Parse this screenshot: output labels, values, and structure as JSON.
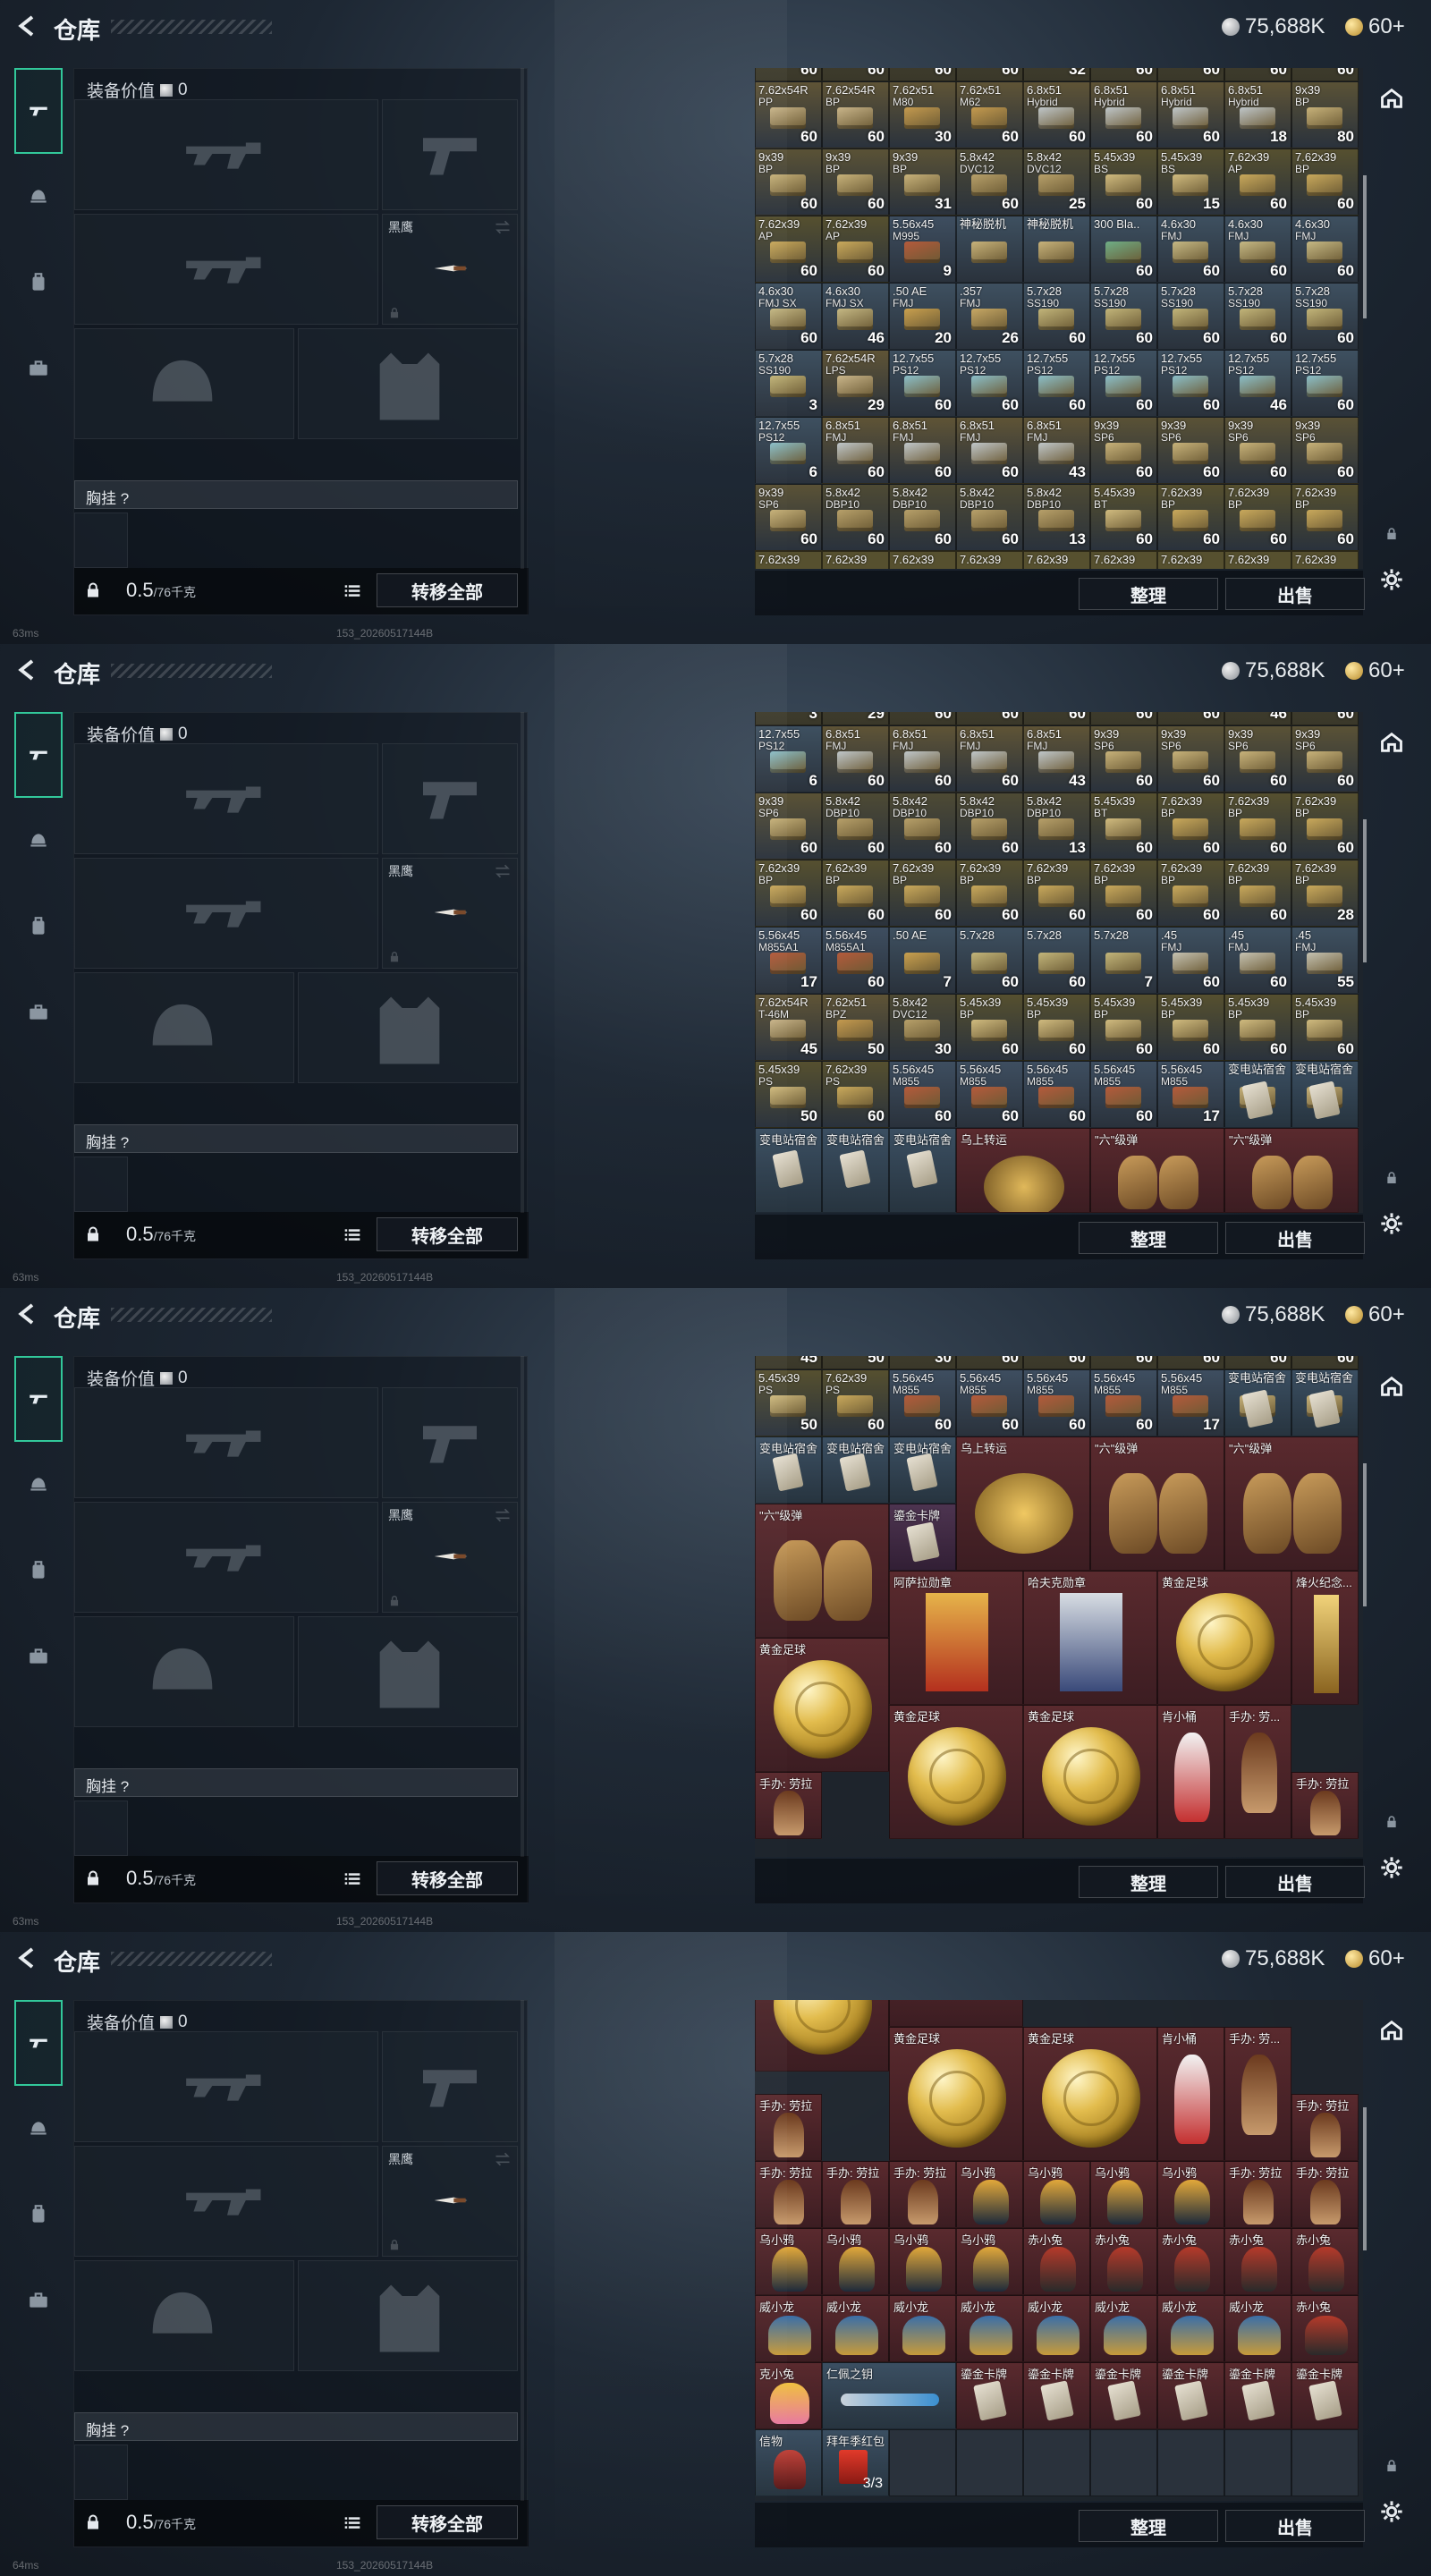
{
  "header": {
    "title": "仓库",
    "silver": "75,688K",
    "gold": "60+"
  },
  "left": {
    "equip_value_label": "装备价值",
    "equip_value": "0",
    "melee_label": "黑鹰",
    "chest_rig_label": "胸挂 ?",
    "weight": "0.5",
    "weight_max": "/76千克",
    "transfer_label": "转移全部"
  },
  "stash_buttons": {
    "sort_label": "整理",
    "sell_label": "出售"
  },
  "status": {
    "ping_1": "63ms",
    "ping_4": "64ms",
    "build_id": "153_20260517144B"
  },
  "screens": [
    {
      "top_counts": [
        "60",
        "60",
        "60",
        "60",
        "32",
        "60",
        "60",
        "60",
        "60"
      ],
      "rows": [
        [
          [
            "7.62x54R",
            "PP",
            "60"
          ],
          [
            "7.62x54R",
            "BP",
            "60"
          ],
          [
            "7.62x51",
            "M80",
            "30"
          ],
          [
            "7.62x51",
            "M62",
            "60"
          ],
          [
            "6.8x51",
            "Hybrid",
            "60"
          ],
          [
            "6.8x51",
            "Hybrid",
            "60"
          ],
          [
            "6.8x51",
            "Hybrid",
            "60"
          ],
          [
            "6.8x51",
            "Hybrid",
            "18"
          ],
          [
            "9x39",
            "BP",
            "80"
          ]
        ],
        [
          [
            "9x39",
            "BP",
            "60"
          ],
          [
            "9x39",
            "BP",
            "60"
          ],
          [
            "9x39",
            "BP",
            "31"
          ],
          [
            "5.8x42",
            "DVC12",
            "60"
          ],
          [
            "5.8x42",
            "DVC12",
            "25"
          ],
          [
            "5.45x39",
            "BS",
            "60"
          ],
          [
            "5.45x39",
            "BS",
            "15"
          ],
          [
            "7.62x39",
            "AP",
            "60"
          ],
          [
            "7.62x39",
            "BP",
            "60"
          ]
        ],
        [
          [
            "7.62x39",
            "AP",
            "60"
          ],
          [
            "7.62x39",
            "AP",
            "60"
          ],
          [
            "5.56x45",
            "M995",
            "9"
          ],
          [
            "神秘脱机",
            "",
            ""
          ],
          [
            "神秘脱机",
            "",
            ""
          ],
          [
            "300 Bla..",
            "",
            "60"
          ],
          [
            "4.6x30",
            "FMJ",
            "60"
          ],
          [
            "4.6x30",
            "FMJ",
            "60"
          ],
          [
            "4.6x30",
            "FMJ",
            "60"
          ]
        ],
        [
          [
            "4.6x30",
            "FMJ SX",
            "60"
          ],
          [
            "4.6x30",
            "FMJ SX",
            "46"
          ],
          [
            ".50 AE",
            "FMJ",
            "20"
          ],
          [
            ".357",
            "FMJ",
            "26"
          ],
          [
            "5.7x28",
            "SS190",
            "60"
          ],
          [
            "5.7x28",
            "SS190",
            "60"
          ],
          [
            "5.7x28",
            "SS190",
            "60"
          ],
          [
            "5.7x28",
            "SS190",
            "60"
          ],
          [
            "5.7x28",
            "SS190",
            "60"
          ]
        ],
        [
          [
            "5.7x28",
            "SS190",
            "3"
          ],
          [
            "7.62x54R",
            "LPS",
            "29"
          ],
          [
            "12.7x55",
            "PS12",
            "60"
          ],
          [
            "12.7x55",
            "PS12",
            "60"
          ],
          [
            "12.7x55",
            "PS12",
            "60"
          ],
          [
            "12.7x55",
            "PS12",
            "60"
          ],
          [
            "12.7x55",
            "PS12",
            "60"
          ],
          [
            "12.7x55",
            "PS12",
            "46"
          ],
          [
            "12.7x55",
            "PS12",
            "60"
          ]
        ],
        [
          [
            "12.7x55",
            "PS12",
            "6"
          ],
          [
            "6.8x51",
            "FMJ",
            "60"
          ],
          [
            "6.8x51",
            "FMJ",
            "60"
          ],
          [
            "6.8x51",
            "FMJ",
            "60"
          ],
          [
            "6.8x51",
            "FMJ",
            "43"
          ],
          [
            "9x39",
            "SP6",
            "60"
          ],
          [
            "9x39",
            "SP6",
            "60"
          ],
          [
            "9x39",
            "SP6",
            "60"
          ],
          [
            "9x39",
            "SP6",
            "60"
          ]
        ],
        [
          [
            "9x39",
            "SP6",
            "60"
          ],
          [
            "5.8x42",
            "DBP10",
            "60"
          ],
          [
            "5.8x42",
            "DBP10",
            "60"
          ],
          [
            "5.8x42",
            "DBP10",
            "60"
          ],
          [
            "5.8x42",
            "DBP10",
            "13"
          ],
          [
            "5.45x39",
            "BT",
            "60"
          ],
          [
            "7.62x39",
            "BP",
            "60"
          ],
          [
            "7.62x39",
            "BP",
            "60"
          ],
          [
            "7.62x39",
            "BP",
            "60"
          ]
        ]
      ],
      "bottom_names": [
        "7.62x39",
        "7.62x39",
        "7.62x39",
        "7.62x39",
        "7.62x39",
        "7.62x39",
        "7.62x39",
        "7.62x39",
        "7.62x39"
      ]
    },
    {
      "top_counts": [
        "3",
        "29",
        "60",
        "60",
        "60",
        "60",
        "60",
        "46",
        "60"
      ],
      "rows": [
        [
          [
            "12.7x55",
            "PS12",
            "6"
          ],
          [
            "6.8x51",
            "FMJ",
            "60"
          ],
          [
            "6.8x51",
            "FMJ",
            "60"
          ],
          [
            "6.8x51",
            "FMJ",
            "60"
          ],
          [
            "6.8x51",
            "FMJ",
            "43"
          ],
          [
            "9x39",
            "SP6",
            "60"
          ],
          [
            "9x39",
            "SP6",
            "60"
          ],
          [
            "9x39",
            "SP6",
            "60"
          ],
          [
            "9x39",
            "SP6",
            "60"
          ]
        ],
        [
          [
            "9x39",
            "SP6",
            "60"
          ],
          [
            "5.8x42",
            "DBP10",
            "60"
          ],
          [
            "5.8x42",
            "DBP10",
            "60"
          ],
          [
            "5.8x42",
            "DBP10",
            "60"
          ],
          [
            "5.8x42",
            "DBP10",
            "13"
          ],
          [
            "5.45x39",
            "BT",
            "60"
          ],
          [
            "7.62x39",
            "BP",
            "60"
          ],
          [
            "7.62x39",
            "BP",
            "60"
          ],
          [
            "7.62x39",
            "BP",
            "60"
          ]
        ],
        [
          [
            "7.62x39",
            "BP",
            "60"
          ],
          [
            "7.62x39",
            "BP",
            "60"
          ],
          [
            "7.62x39",
            "BP",
            "60"
          ],
          [
            "7.62x39",
            "BP",
            "60"
          ],
          [
            "7.62x39",
            "BP",
            "60"
          ],
          [
            "7.62x39",
            "BP",
            "60"
          ],
          [
            "7.62x39",
            "BP",
            "60"
          ],
          [
            "7.62x39",
            "BP",
            "60"
          ],
          [
            "7.62x39",
            "BP",
            "28"
          ]
        ],
        [
          [
            "5.56x45",
            "M855A1",
            "17"
          ],
          [
            "5.56x45",
            "M855A1",
            "60"
          ],
          [
            ".50 AE",
            "",
            "7"
          ],
          [
            "5.7x28",
            "",
            "60"
          ],
          [
            "5.7x28",
            "",
            "60"
          ],
          [
            "5.7x28",
            "",
            "7"
          ],
          [
            ".45",
            "FMJ",
            "60"
          ],
          [
            ".45",
            "FMJ",
            "60"
          ],
          [
            ".45",
            "FMJ",
            "55"
          ]
        ],
        [
          [
            "7.62x54R",
            "T-46M",
            "45"
          ],
          [
            "7.62x51",
            "BPZ",
            "50"
          ],
          [
            "5.8x42",
            "DVC12",
            "30"
          ],
          [
            "5.45x39",
            "BP",
            "60"
          ],
          [
            "5.45x39",
            "BP",
            "60"
          ],
          [
            "5.45x39",
            "BP",
            "60"
          ],
          [
            "5.45x39",
            "BP",
            "60"
          ],
          [
            "5.45x39",
            "BP",
            "60"
          ],
          [
            "5.45x39",
            "BP",
            "60"
          ]
        ],
        [
          [
            "5.45x39",
            "PS",
            "50"
          ],
          [
            "7.62x39",
            "PS",
            "60"
          ],
          [
            "5.56x45",
            "M855",
            "60"
          ],
          [
            "5.56x45",
            "M855",
            "60"
          ],
          [
            "5.56x45",
            "M855",
            "60"
          ],
          [
            "5.56x45",
            "M855",
            "60"
          ],
          [
            "5.56x45",
            "M855",
            "17"
          ],
          [
            "变电站宿舍",
            "",
            ""
          ],
          [
            "变电站宿舍",
            "",
            ""
          ]
        ]
      ],
      "special_row_names": [
        "变电站宿舍",
        "变电站宿舍",
        "变电站宿舍",
        "乌上转运",
        "\"六\"级弹",
        "\"六\"级弹"
      ]
    },
    {
      "top_counts": [
        "45",
        "50",
        "30",
        "60",
        "60",
        "60",
        "60",
        "60",
        "60"
      ],
      "row1": [
        [
          "5.45x39",
          "PS",
          "50"
        ],
        [
          "7.62x39",
          "PS",
          "60"
        ],
        [
          "5.56x45",
          "M855",
          "60"
        ],
        [
          "5.56x45",
          "M855",
          "60"
        ],
        [
          "5.56x45",
          "M855",
          "60"
        ],
        [
          "5.56x45",
          "M855",
          "60"
        ],
        [
          "5.56x45",
          "M855",
          "17"
        ],
        [
          "变电站宿舍",
          "",
          ""
        ],
        [
          "变电站宿舍",
          "",
          ""
        ]
      ],
      "names": {
        "dorm": "变电站宿舍",
        "transfer": "乌上转运",
        "six": "\"六\"级弹",
        "badge_a": "阿萨拉勋章",
        "badge_b": "哈夫克勋章",
        "gold_ball": "黄金足球",
        "trophy": "烽火纪念...",
        "card": "鎏金卡牌",
        "bucket": "肯小桶",
        "fig_a": "手办: 劳...",
        "fig_b": "手办: 劳拉"
      }
    },
    {
      "names": {
        "gold_ball": "黄金足球",
        "bucket": "肯小桶",
        "fig_a": "手办: 劳...",
        "fig_b": "手办: 劳拉",
        "crow": "乌小鸦",
        "chi": "赤小兔",
        "wei": "威小龙",
        "ke": "克小兔",
        "key": "仁佩之钥",
        "card": "鎏金卡牌",
        "mask": "信物",
        "envelope": "拜年季红包",
        "envelope_count": "3/3"
      }
    }
  ]
}
